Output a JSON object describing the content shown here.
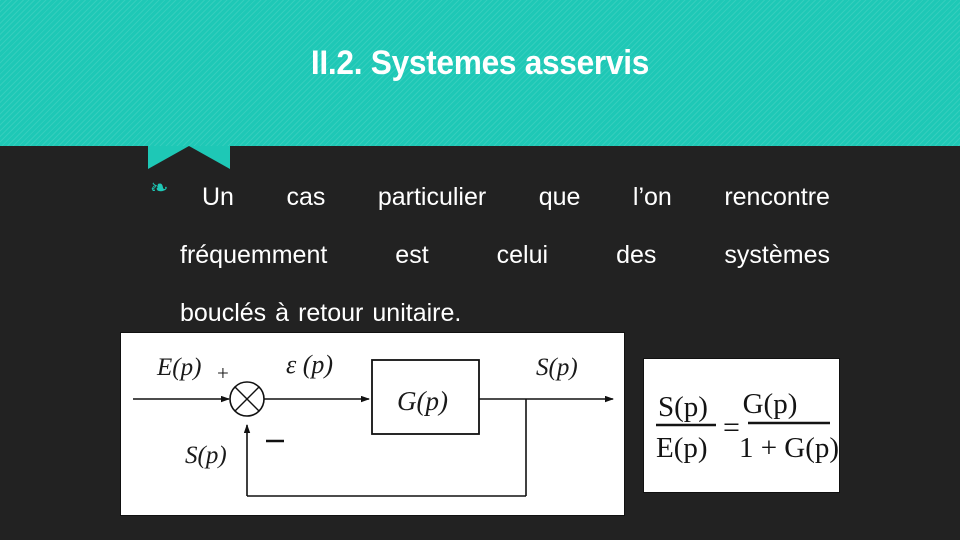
{
  "slide": {
    "title": "II.2. Systemes asservis",
    "accent_color": "#1ec8b6",
    "background_color": "#222222",
    "title_color": "#ffffff"
  },
  "body": {
    "bullet_glyph": "❧",
    "line1_words": [
      "Un",
      "cas",
      "particulier",
      "que",
      "l’on",
      "rencontre"
    ],
    "line2_words": [
      "fréquemment",
      "est",
      "celui",
      "des",
      "systèmes"
    ],
    "line3_words": [
      "bouclés",
      "à",
      "retour",
      "unitaire."
    ],
    "full_text": "Un cas particulier que l’on rencontre fréquemment est celui des systèmes bouclés à retour unitaire."
  },
  "diagram": {
    "input_label": "E(p)",
    "plus_sign": "+",
    "minus_sign": "–",
    "error_label": "ε (p)",
    "block_label": "G(p)",
    "output_label": "S(p)",
    "feedback_label": "S(p)"
  },
  "formula": {
    "lhs_numerator": "S(p)",
    "lhs_denominator": "E(p)",
    "equals": "=",
    "rhs_numerator": "G(p)",
    "rhs_denominator": "1 + G(p)"
  }
}
